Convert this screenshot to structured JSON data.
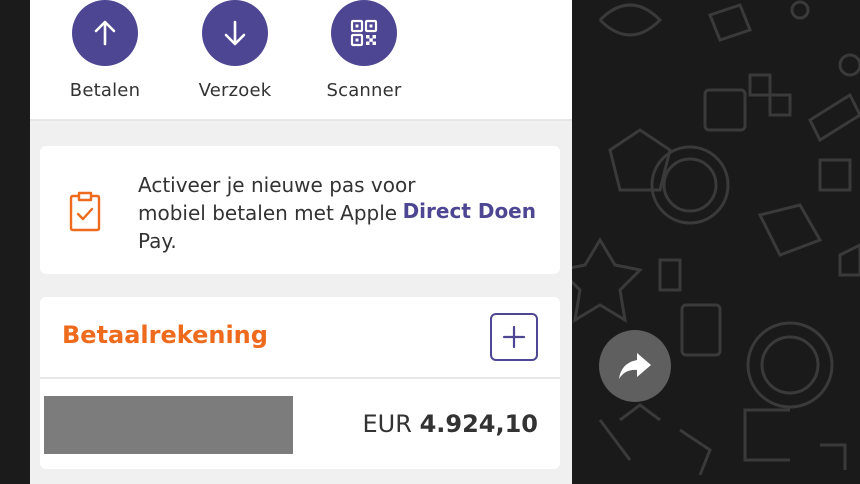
{
  "actions": [
    {
      "label": "Betalen",
      "icon": "arrow-up-icon"
    },
    {
      "label": "Verzoek",
      "icon": "arrow-down-icon"
    },
    {
      "label": "Scanner",
      "icon": "qr-code-icon"
    }
  ],
  "promo": {
    "text": "Activeer je nieuwe pas voor mobiel betalen met Apple Pay.",
    "link": "Direct Doen",
    "icon": "clipboard-check-icon"
  },
  "account": {
    "title": "Betaalrekening",
    "currency": "EUR",
    "amount": "4.924,10"
  },
  "colors": {
    "accent": "#4d4693",
    "orange": "#ee6a1c",
    "background": "#f0f0f0"
  }
}
